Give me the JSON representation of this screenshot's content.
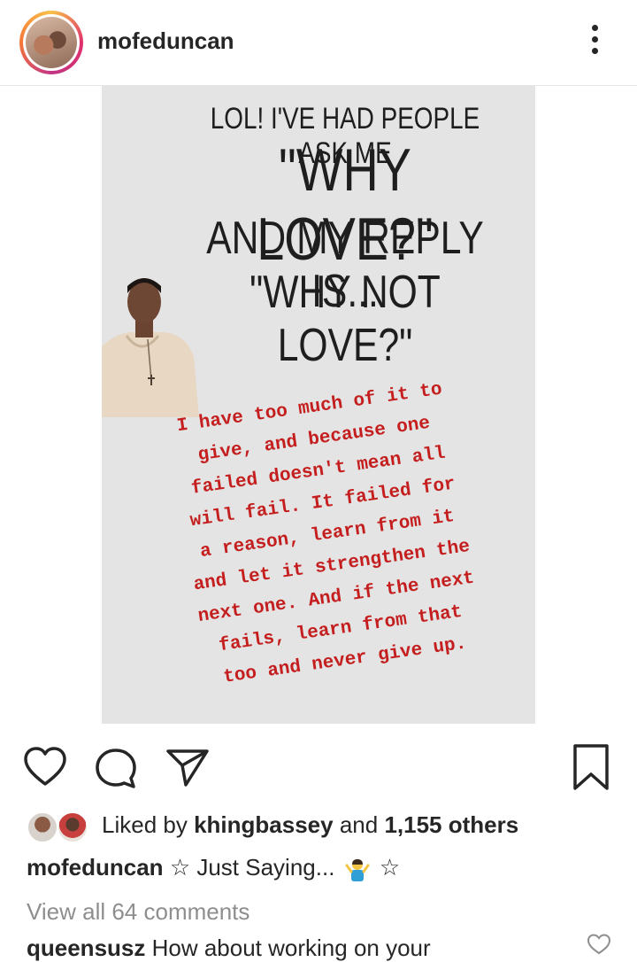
{
  "header": {
    "username": "mofeduncan",
    "more_icon": "more-vertical-icon"
  },
  "post": {
    "quote_line1": "LOL! I'VE HAD PEOPLE ASK ME",
    "quote_line2": "\"WHY LOVE?\"",
    "quote_line3": "AND MY REPLY IS...",
    "quote_line4": "\"WHY NOT LOVE?\"",
    "handwritten_lines": [
      "I have too much of it to",
      "give, and because one",
      "failed doesn't mean all",
      "will fail. It failed for",
      "a reason, learn from it",
      "and let it strengthen the",
      "next one. And if the next",
      "fails, learn from that",
      "too and never give up."
    ]
  },
  "actions": {
    "like_icon": "heart-icon",
    "comment_icon": "comment-icon",
    "share_icon": "paper-plane-icon",
    "save_icon": "bookmark-icon"
  },
  "likes": {
    "prefix": "Liked by",
    "user": "khingbassey",
    "middle": "and",
    "others": "1,155 others"
  },
  "caption": {
    "username": "mofeduncan",
    "text_before": "☆ Just Saying...",
    "text_after": "☆",
    "emoji": "person-shrugging-emoji"
  },
  "view_comments": "View all 64 comments",
  "comment": {
    "username": "queensusz",
    "text": "How about working on your"
  },
  "colors": {
    "accent_red": "#c41e1e",
    "muted_text": "#8e8e8e",
    "story_bg": "#e4e4e4"
  }
}
